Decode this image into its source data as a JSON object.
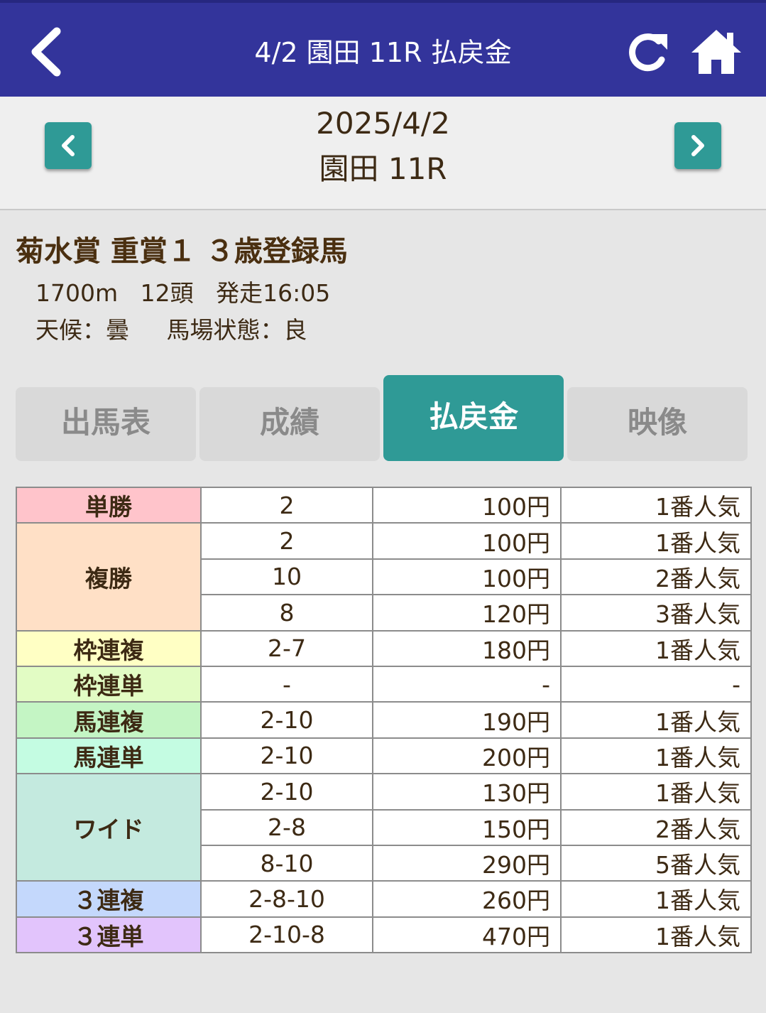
{
  "header": {
    "title": "4/2 園田 11R 払戻金",
    "background": "#33349b"
  },
  "date_nav": {
    "date": "2025/4/2",
    "race": "園田 11R"
  },
  "race": {
    "name": "菊水賞 重賞１ ３歳登録馬",
    "distance": "1700m",
    "horses": "12頭",
    "start": "発走16:05",
    "weather": "天候：曇",
    "track": "馬場状態：良"
  },
  "tabs": [
    {
      "label": "出馬表",
      "active": false
    },
    {
      "label": "成績",
      "active": false
    },
    {
      "label": "払戻金",
      "active": true
    },
    {
      "label": "映像",
      "active": false
    }
  ],
  "accent_color": "#2f9a96",
  "payouts": [
    {
      "type": "単勝",
      "color": "#ffc4cb",
      "rows": [
        {
          "combo": "2",
          "amount": "100円",
          "pop": "1番人気"
        }
      ]
    },
    {
      "type": "複勝",
      "color": "#ffe0c6",
      "rows": [
        {
          "combo": "2",
          "amount": "100円",
          "pop": "1番人気"
        },
        {
          "combo": "10",
          "amount": "100円",
          "pop": "2番人気"
        },
        {
          "combo": "8",
          "amount": "120円",
          "pop": "3番人気"
        }
      ]
    },
    {
      "type": "枠連複",
      "color": "#ffffc4",
      "rows": [
        {
          "combo": "2-7",
          "amount": "180円",
          "pop": "1番人気"
        }
      ]
    },
    {
      "type": "枠連単",
      "color": "#e2fcc4",
      "rows": [
        {
          "combo": "-",
          "amount": "-",
          "pop": "-"
        }
      ]
    },
    {
      "type": "馬連複",
      "color": "#c4f5c4",
      "rows": [
        {
          "combo": "2-10",
          "amount": "190円",
          "pop": "1番人気"
        }
      ]
    },
    {
      "type": "馬連単",
      "color": "#c4fce2",
      "rows": [
        {
          "combo": "2-10",
          "amount": "200円",
          "pop": "1番人気"
        }
      ]
    },
    {
      "type": "ワイド",
      "color": "#c4eadf",
      "rows": [
        {
          "combo": "2-10",
          "amount": "130円",
          "pop": "1番人気"
        },
        {
          "combo": "2-8",
          "amount": "150円",
          "pop": "2番人気"
        },
        {
          "combo": "8-10",
          "amount": "290円",
          "pop": "5番人気"
        }
      ]
    },
    {
      "type": "３連複",
      "color": "#c4d8fc",
      "rows": [
        {
          "combo": "2-8-10",
          "amount": "260円",
          "pop": "1番人気"
        }
      ]
    },
    {
      "type": "３連単",
      "color": "#e2c4fc",
      "rows": [
        {
          "combo": "2-10-8",
          "amount": "470円",
          "pop": "1番人気"
        }
      ]
    }
  ]
}
